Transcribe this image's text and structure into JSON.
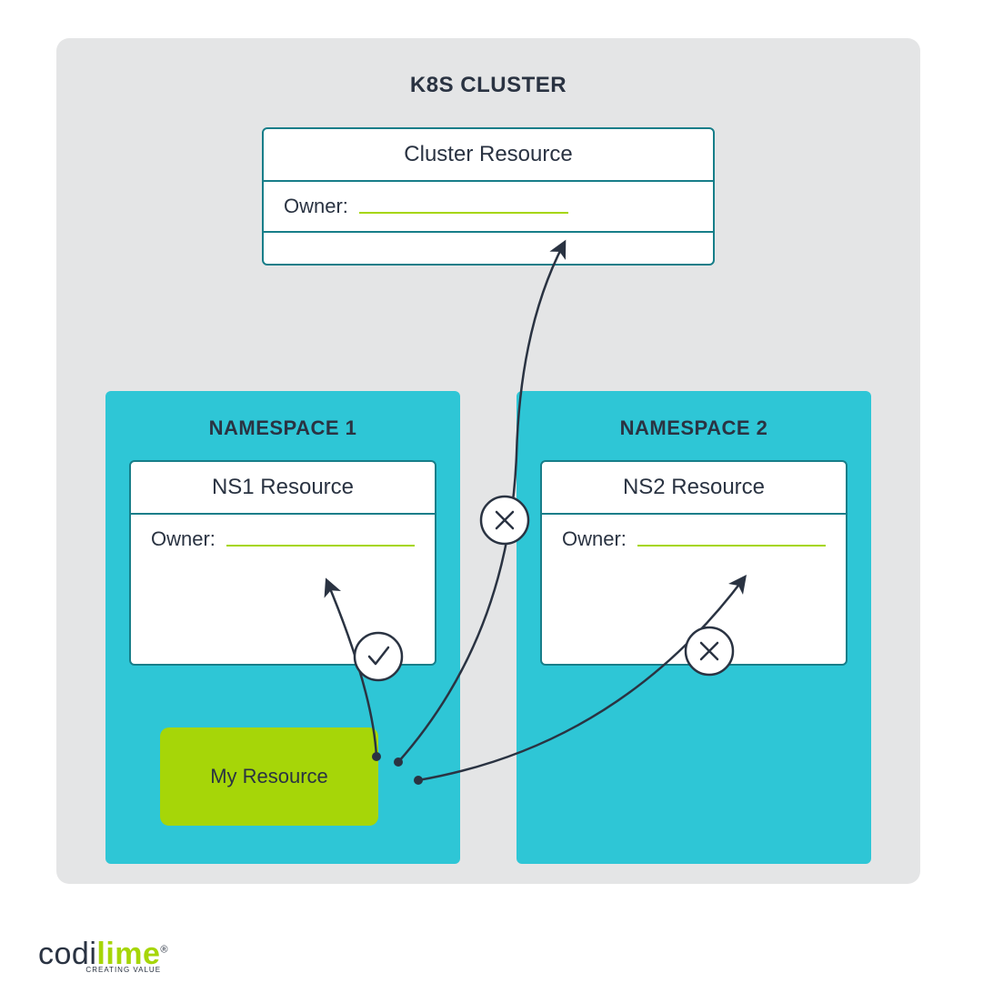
{
  "cluster": {
    "title": "K8S CLUSTER",
    "resource": {
      "title": "Cluster Resource",
      "owner_label": "Owner:"
    }
  },
  "namespace1": {
    "title": "NAMESPACE 1",
    "resource": {
      "title": "NS1 Resource",
      "owner_label": "Owner:"
    },
    "my_resource": "My Resource"
  },
  "namespace2": {
    "title": "NAMESPACE 2",
    "resource": {
      "title": "NS2 Resource",
      "owner_label": "Owner:"
    }
  },
  "arrows": {
    "to_ns1": "allowed",
    "to_cluster": "denied",
    "to_ns2": "denied"
  },
  "logo": {
    "name_part1": "codi",
    "name_part2": "lime",
    "registered": "®",
    "tagline": "CREATING VALUE"
  },
  "colors": {
    "panel_bg": "#e4e5e6",
    "card_border": "#177e89",
    "namespace_bg": "#2ec6d6",
    "accent_green": "#a6d608",
    "ink": "#2a3342"
  }
}
